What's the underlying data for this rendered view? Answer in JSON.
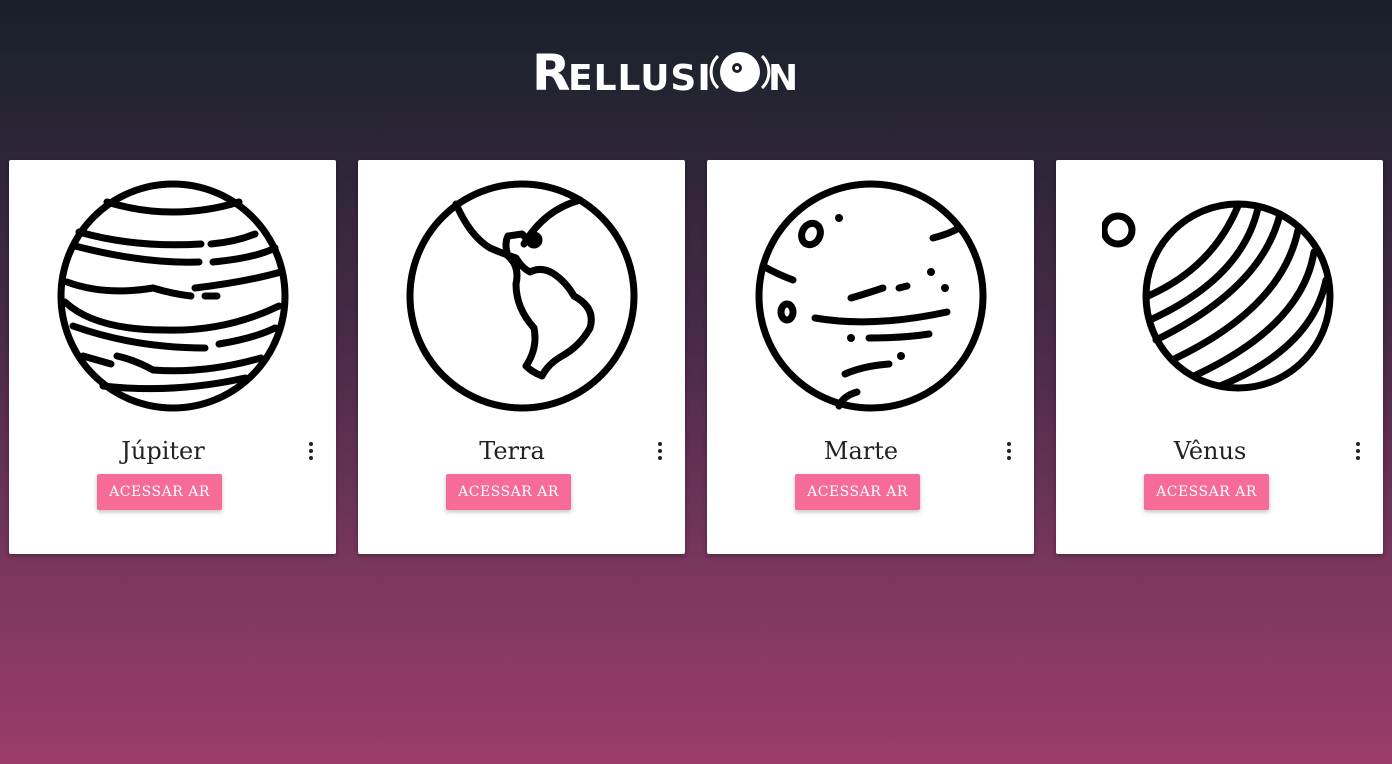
{
  "brand": {
    "logo_text": "RELLUSION",
    "logo_prefix": "RELLUSI",
    "logo_suffix": "N",
    "color": "#ffffff"
  },
  "colors": {
    "button_bg": "#f76b98",
    "card_bg": "#ffffff",
    "background_top": "#18202a",
    "background_bottom": "#9b3c6b"
  },
  "cards": [
    {
      "title": "Júpiter",
      "button_label": "ACESSAR AR",
      "icon": "jupiter-icon",
      "menu_icon": "more-vert-icon"
    },
    {
      "title": "Terra",
      "button_label": "ACESSAR AR",
      "icon": "earth-icon",
      "menu_icon": "more-vert-icon"
    },
    {
      "title": "Marte",
      "button_label": "ACESSAR AR",
      "icon": "mars-icon",
      "menu_icon": "more-vert-icon"
    },
    {
      "title": "Vênus",
      "button_label": "ACESSAR AR",
      "icon": "venus-icon",
      "menu_icon": "more-vert-icon"
    }
  ]
}
